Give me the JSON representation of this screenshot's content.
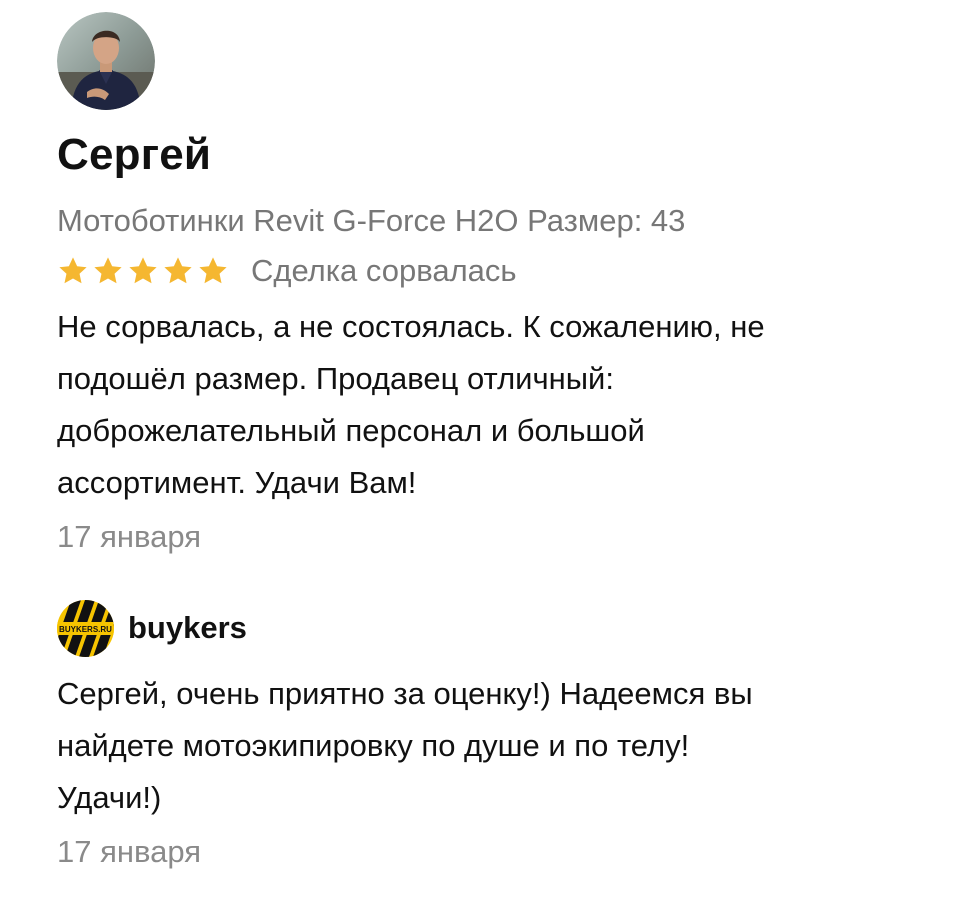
{
  "review": {
    "author_name": "Сергей",
    "product": "Мотоботинки Revit G-Force H2O Размер: 43",
    "rating": 5,
    "rating_max": 5,
    "star_color": "#F5B731",
    "deal_status": "Сделка сорвалась",
    "text_lines": [
      "Не сорвалась, а не состоялась. К сожалению, не",
      "подошёл размер. Продавец отличный:",
      "доброжелательный персонал и большой",
      "ассортимент. Удачи Вам!"
    ],
    "date": "17 января"
  },
  "reply": {
    "seller_name": "buykers",
    "logo_text": "BUYKERS.RU",
    "logo_colors": [
      "#F6C400",
      "#111111"
    ],
    "text_lines": [
      "Сергей, очень приятно за оценку!) Надеемся вы",
      "найдете мотоэкипировку по душе и по телу!",
      "Удачи!)"
    ],
    "date": "17 января"
  }
}
